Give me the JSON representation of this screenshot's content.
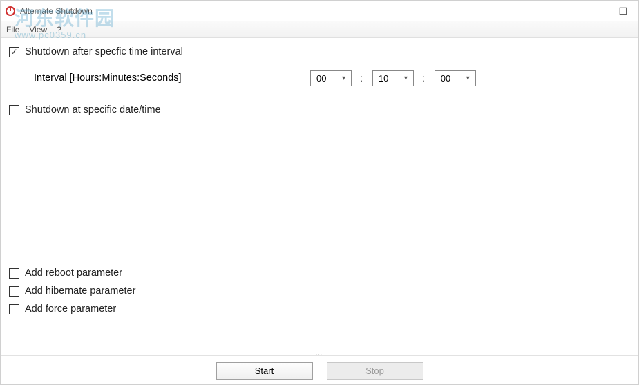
{
  "window": {
    "title": "Alternate Shutdown"
  },
  "menubar": {
    "file": "File",
    "view": "View",
    "help": "?"
  },
  "watermark": {
    "text": "河东软件园",
    "url": "www.pc0359.cn"
  },
  "options": {
    "shutdown_interval_label": "Shutdown after specfic time interval",
    "shutdown_interval_checked": true,
    "interval_caption": "Interval [Hours:Minutes:Seconds]",
    "hours": "00",
    "minutes": "10",
    "seconds": "00",
    "shutdown_datetime_label": "Shutdown at specific date/time",
    "shutdown_datetime_checked": false
  },
  "params": {
    "reboot_label": "Add reboot parameter",
    "reboot_checked": false,
    "hibernate_label": "Add hibernate parameter",
    "hibernate_checked": false,
    "force_label": "Add force parameter",
    "force_checked": false
  },
  "buttons": {
    "start": "Start",
    "stop": "Stop"
  }
}
